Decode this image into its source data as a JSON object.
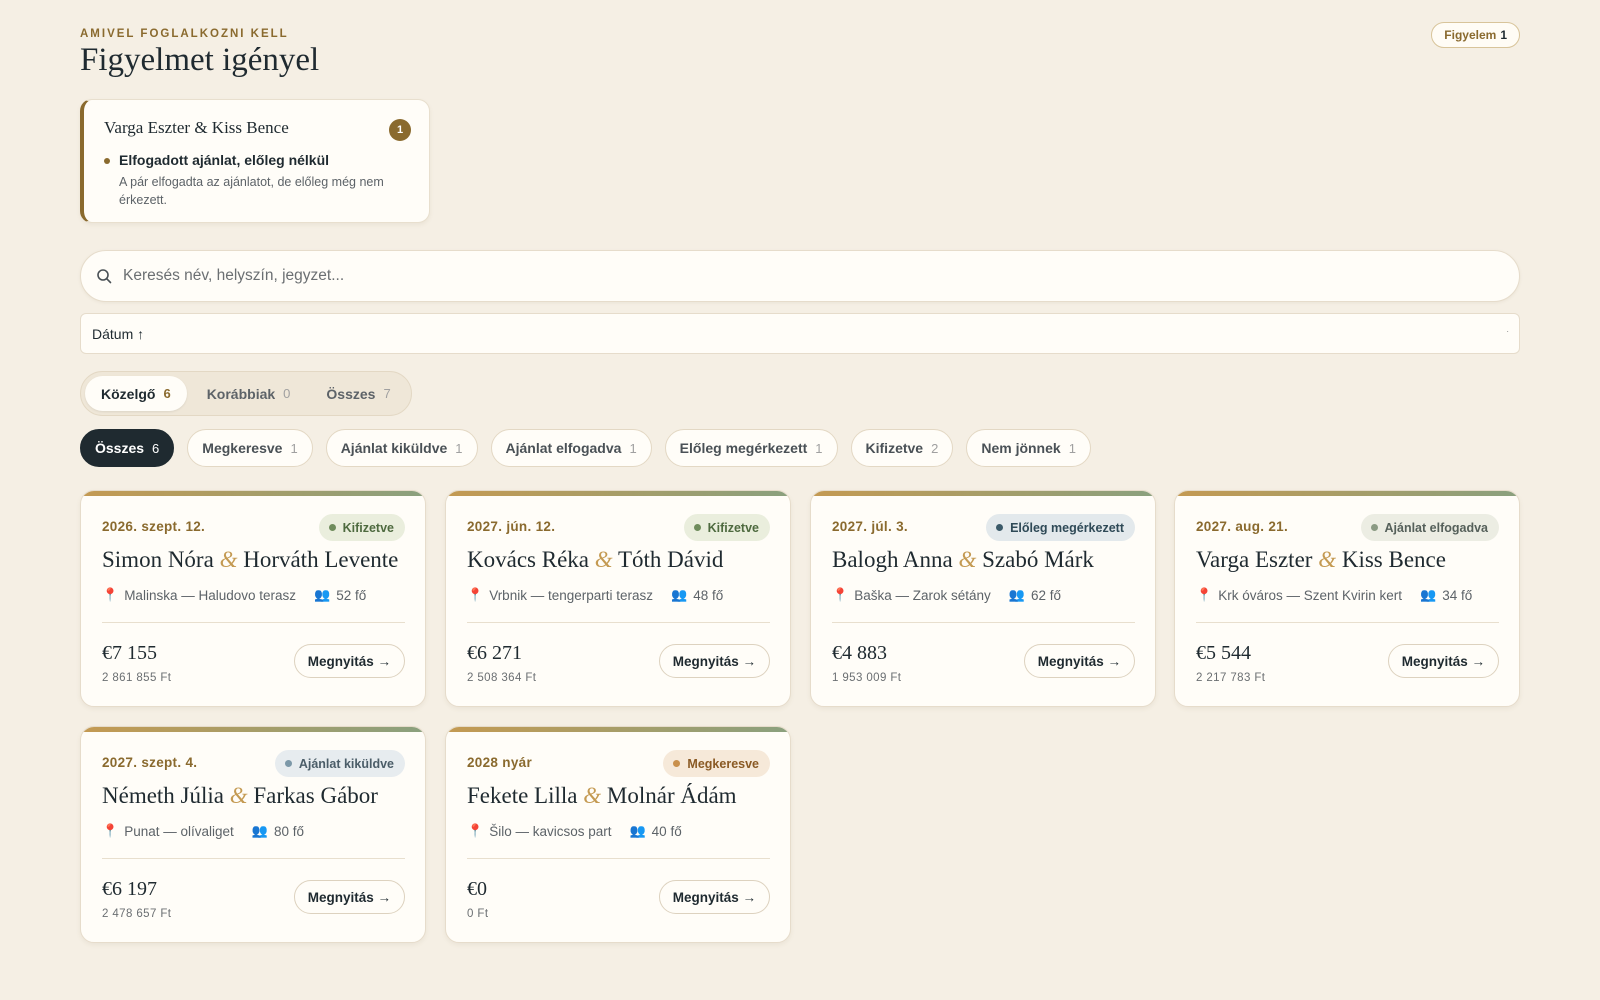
{
  "header": {
    "eyebrow": "AMIVEL FOGLALKOZNI KELL",
    "title": "Figyelmet igényel",
    "alert_label": "Figyelem",
    "alert_count": "1"
  },
  "attention_card": {
    "couple": "Varga Eszter & Kiss Bence",
    "count": "1",
    "issue_title": "Elfogadott ajánlat, előleg nélkül",
    "issue_desc": "A pár elfogadta az ajánlatot, de előleg még nem érkezett."
  },
  "search": {
    "placeholder": "Keresés név, helyszín, jegyzet..."
  },
  "sort": {
    "label": "Dátum ↑"
  },
  "tabs": [
    {
      "label": "Közelgő",
      "count": "6",
      "active": true
    },
    {
      "label": "Korábbiak",
      "count": "0",
      "active": false
    },
    {
      "label": "Összes",
      "count": "7",
      "active": false
    }
  ],
  "filters": [
    {
      "label": "Összes",
      "count": "6",
      "active": true
    },
    {
      "label": "Megkeresve",
      "count": "1"
    },
    {
      "label": "Ajánlat kiküldve",
      "count": "1"
    },
    {
      "label": "Ajánlat elfogadva",
      "count": "1"
    },
    {
      "label": "Előleg megérkezett",
      "count": "1"
    },
    {
      "label": "Kifizetve",
      "count": "2"
    },
    {
      "label": "Nem jönnek",
      "count": "1"
    }
  ],
  "colors": {
    "accent": "#8a6a2e",
    "paid_bg": "#eaeedd",
    "paid_fg": "#4e6a3f",
    "paid_dot": "#6f8c5c",
    "deposit_bg": "#e3e9ec",
    "deposit_fg": "#2f4a57",
    "deposit_dot": "#3b5a69",
    "accepted_bg": "#ecede3",
    "accepted_fg": "#55605a",
    "accepted_dot": "#8a9a83",
    "sent_bg": "#e7ecef",
    "sent_fg": "#4b5d68",
    "sent_dot": "#7c98a8",
    "inquiry_bg": "#f6e9d9",
    "inquiry_fg": "#8a5a24",
    "inquiry_dot": "#c9904c"
  },
  "open_label": "Megnyitás →",
  "cards": [
    {
      "date": "2026. szept. 12.",
      "status": "Kifizetve",
      "status_kind": "paid",
      "name1": "Simon Nóra",
      "amp": "&",
      "name2": "Horváth Levente",
      "place": "Malinska — Haludovo terasz",
      "guests": "52 fő",
      "eur": "€7 155",
      "huf": "2 861 855 Ft"
    },
    {
      "date": "2027. jún. 12.",
      "status": "Kifizetve",
      "status_kind": "paid",
      "name1": "Kovács Réka",
      "amp": "&",
      "name2": "Tóth Dávid",
      "place": "Vrbnik — tengerparti terasz",
      "guests": "48 fő",
      "eur": "€6 271",
      "huf": "2 508 364 Ft"
    },
    {
      "date": "2027. júl. 3.",
      "status": "Előleg megérkezett",
      "status_kind": "deposit",
      "name1": "Balogh Anna",
      "amp": "&",
      "name2": "Szabó Márk",
      "place": "Baška — Zarok sétány",
      "guests": "62 fő",
      "eur": "€4 883",
      "huf": "1 953 009 Ft"
    },
    {
      "date": "2027. aug. 21.",
      "status": "Ajánlat elfogadva",
      "status_kind": "accepted",
      "name1": "Varga Eszter",
      "amp": "&",
      "name2": "Kiss Bence",
      "place": "Krk óváros — Szent Kvirin kert",
      "guests": "34 fő",
      "eur": "€5 544",
      "huf": "2 217 783 Ft"
    },
    {
      "date": "2027. szept. 4.",
      "status": "Ajánlat kiküldve",
      "status_kind": "sent",
      "name1": "Németh Júlia",
      "amp": "&",
      "name2": "Farkas Gábor",
      "place": "Punat — olívaliget",
      "guests": "80 fő",
      "eur": "€6 197",
      "huf": "2 478 657 Ft"
    },
    {
      "date": "2028 nyár",
      "status": "Megkeresve",
      "status_kind": "inquiry",
      "name1": "Fekete Lilla",
      "amp": "&",
      "name2": "Molnár Ádám",
      "place": "Šilo — kavicsos part",
      "guests": "40 fő",
      "eur": "€0",
      "huf": "0 Ft"
    }
  ]
}
